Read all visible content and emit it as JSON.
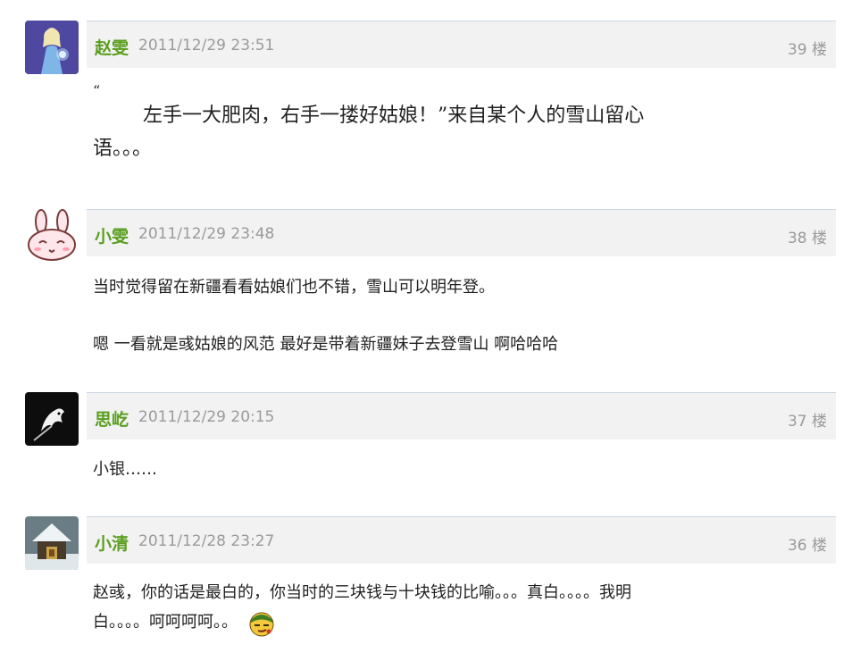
{
  "comments": [
    {
      "author": "赵雯",
      "time": "2011/12/29 23:51",
      "floor": "39 楼",
      "avatar_icon": "frozen-princess-avatar",
      "lines": [
        "“",
        "左手一大肥肉，右手一搂好姑娘！”来自某个人的雪山留心",
        "语。。。"
      ]
    },
    {
      "author": "小雯",
      "time": "2011/12/29 23:48",
      "floor": "38 楼",
      "avatar_icon": "pink-bunny-avatar",
      "lines": [
        "当时觉得留在新疆看看姑娘们也不错，雪山可以明年登。",
        "嗯 一看就是彧姑娘的风范 最好是带着新疆妹子去登雪山 啊哈哈哈"
      ]
    },
    {
      "author": "思屹",
      "time": "2011/12/29 20:15",
      "floor": "37 楼",
      "avatar_icon": "black-white-bird-avatar",
      "lines": [
        "小银……"
      ]
    },
    {
      "author": "小清",
      "time": "2011/12/28 23:27",
      "floor": "36 楼",
      "avatar_icon": "snowy-cabin-avatar",
      "lines": [
        "赵彧，你的话是最白的，你当时的三块钱与十块钱的比喻。。。真白。。。。我明",
        "白。。。。呵呵呵呵。。"
      ],
      "emoticon": "smug-face-emoticon"
    }
  ],
  "colors": {
    "author": "#5a9e1e",
    "meta": "#9a9a9a",
    "header_bg": "#f2f2f2",
    "header_border": "#c9d6e3"
  }
}
